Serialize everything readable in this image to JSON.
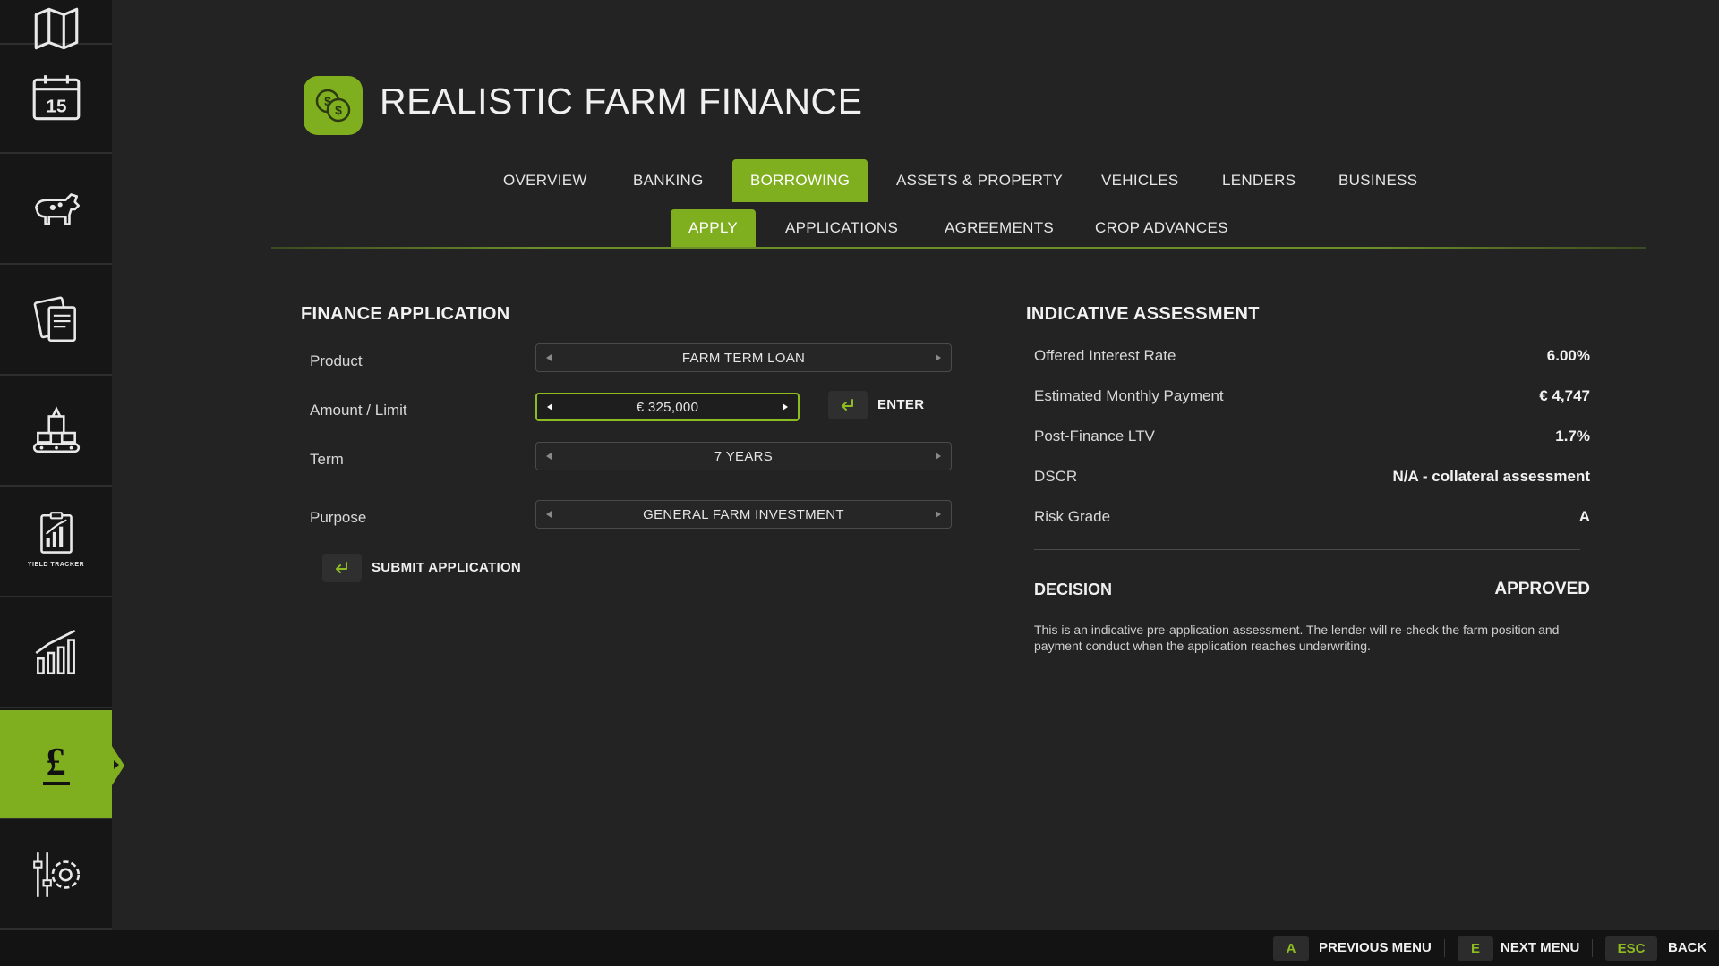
{
  "app": {
    "title": "REALISTIC FARM FINANCE",
    "accent_color": "#7fae1e"
  },
  "sidebar": {
    "items": [
      {
        "icon": "map-icon",
        "active": false
      },
      {
        "icon": "calendar-icon",
        "calendar_day": "15",
        "active": false
      },
      {
        "icon": "livestock-icon",
        "active": false
      },
      {
        "icon": "contracts-icon",
        "active": false
      },
      {
        "icon": "production-icon",
        "active": false
      },
      {
        "icon": "yield-tracker-icon",
        "caption": "YIELD TRACKER",
        "active": false
      },
      {
        "icon": "statistics-icon",
        "active": false
      },
      {
        "icon": "finance-icon",
        "symbol": "£",
        "active": true
      },
      {
        "icon": "settings-icon",
        "active": false
      }
    ]
  },
  "tabs": [
    "OVERVIEW",
    "BANKING",
    "BORROWING",
    "ASSETS & PROPERTY",
    "VEHICLES",
    "LENDERS",
    "BUSINESS"
  ],
  "active_tab": "BORROWING",
  "subtabs": [
    "APPLY",
    "APPLICATIONS",
    "AGREEMENTS",
    "CROP ADVANCES"
  ],
  "active_subtab": "APPLY",
  "application": {
    "title": "FINANCE APPLICATION",
    "fields": {
      "product": {
        "label": "Product",
        "value": "FARM TERM LOAN"
      },
      "amount": {
        "label": "Amount / Limit",
        "value": "€ 325,000"
      },
      "term": {
        "label": "Term",
        "value": "7 YEARS"
      },
      "purpose": {
        "label": "Purpose",
        "value": "GENERAL FARM INVESTMENT"
      }
    },
    "enter_label": "ENTER",
    "submit_label": "SUBMIT APPLICATION"
  },
  "assessment": {
    "title": "INDICATIVE ASSESSMENT",
    "rows": [
      {
        "label": "Offered Interest Rate",
        "value": "6.00%"
      },
      {
        "label": "Estimated Monthly Payment",
        "value": "€ 4,747"
      },
      {
        "label": "Post-Finance LTV",
        "value": "1.7%"
      },
      {
        "label": "DSCR",
        "value": "N/A - collateral assessment"
      },
      {
        "label": "Risk Grade",
        "value": "A"
      }
    ],
    "decision_label": "DECISION",
    "decision_value": "APPROVED",
    "note": "This is an indicative pre-application assessment. The lender will re-check the farm position and payment conduct when the application reaches underwriting."
  },
  "footer": {
    "prev": {
      "key": "A",
      "label": "PREVIOUS MENU"
    },
    "next": {
      "key": "E",
      "label": "NEXT MENU"
    },
    "back": {
      "key": "ESC",
      "label": "BACK"
    }
  }
}
